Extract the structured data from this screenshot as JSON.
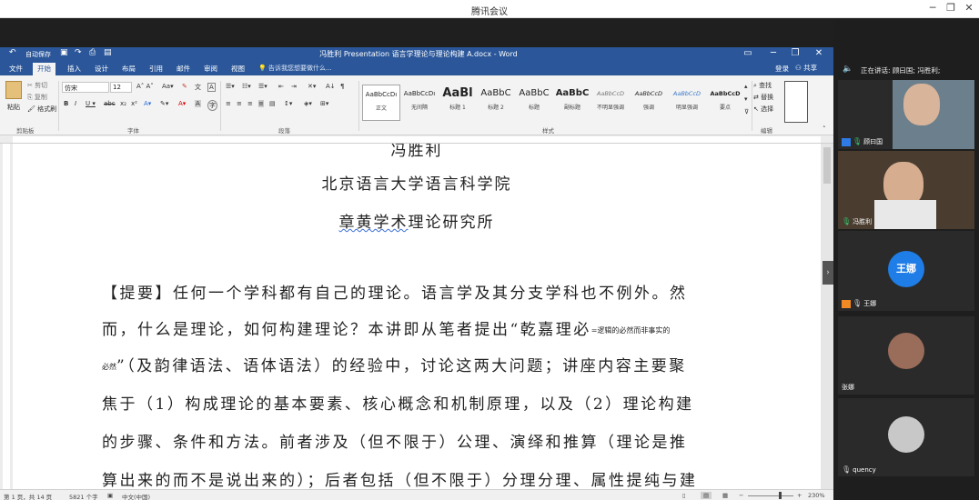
{
  "meeting": {
    "title": "腾讯会议",
    "minimize": "─",
    "restore": "❐",
    "close": "✕"
  },
  "word": {
    "window_title": "冯胜利 Presentation 语言学理论与理论构建 A.docx - Word",
    "autosave": "自动保存",
    "accent": "#2b579a",
    "menu": [
      "文件",
      "开始",
      "插入",
      "设计",
      "布局",
      "引用",
      "邮件",
      "审阅",
      "视图"
    ],
    "tell_me": "告诉我您想要做什么...",
    "login": "登录",
    "share": "共享",
    "ribbon": {
      "clipboard": {
        "paste": "粘贴",
        "cut": "剪切",
        "copy": "复制",
        "format_painter": "格式刷",
        "group": "剪贴板"
      },
      "font": {
        "name": "仿宋",
        "size": "12",
        "group": "字体"
      },
      "paragraph": {
        "group": "段落"
      },
      "styles": {
        "group": "样式",
        "items": [
          {
            "sample": "AaBbCcDı",
            "name": "正文"
          },
          {
            "sample": "AaBbCcDı",
            "name": "无间隔"
          },
          {
            "sample": "AaBl",
            "name": "标题 1"
          },
          {
            "sample": "AaBbC",
            "name": "标题 2"
          },
          {
            "sample": "AaBbC",
            "name": "标题"
          },
          {
            "sample": "AaBbC",
            "name": "副标题"
          },
          {
            "sample": "AaBbCcD",
            "name": "不明显强调"
          },
          {
            "sample": "AaBbCcD",
            "name": "强调"
          },
          {
            "sample": "AaBbCcD",
            "name": "明显强调"
          },
          {
            "sample": "AaBbCcD",
            "name": "要点"
          }
        ]
      },
      "editing": {
        "find": "查找",
        "replace": "替换",
        "select": "选择",
        "group": "编辑"
      }
    },
    "document": {
      "line0": "冯胜利",
      "line1": "北京语言大学语言科学院",
      "line2_a": "章黄学术",
      "line2_b": "理论研究所",
      "para": [
        "【提要】任何一个学科都有自己的理论。语言学及其分支学科也不例外。然",
        "而，什么是理论，如何构建理论？本讲即从笔者提出“乾嘉理必",
        "”（及韵律语法、语体语法）的经验中，讨论这两大问题；讲座内容主要聚",
        "焦于（1）构成理论的基本要素、核心概念和机制原理，以及（2）理论构建",
        "的步骤、条件和方法。前者涉及（但不限于）公理、演绎和推算（理论是推",
        "算出来的而不是说出来的）；后者包括（但不限于）分理分理、属性提纯与建"
      ],
      "note_inline": "=逻辑的必然而非事实的",
      "note_wrap": "必然"
    },
    "status": {
      "page": "第 1 页，共 14 页",
      "words": "5821 个字",
      "lang": "中文(中国)",
      "zoom": "230%"
    }
  },
  "participants": {
    "speaking": "正在讲话: 顾曰国; 冯胜利;",
    "tiles": [
      {
        "name": "顾曰国",
        "type": "video"
      },
      {
        "name": "冯胜利",
        "type": "video"
      },
      {
        "name": "王娜",
        "type": "avatar",
        "avatar_text": "王娜",
        "color": "#1e7de6"
      },
      {
        "name": "张娜",
        "type": "photo"
      },
      {
        "name": "quency",
        "type": "default"
      }
    ]
  }
}
